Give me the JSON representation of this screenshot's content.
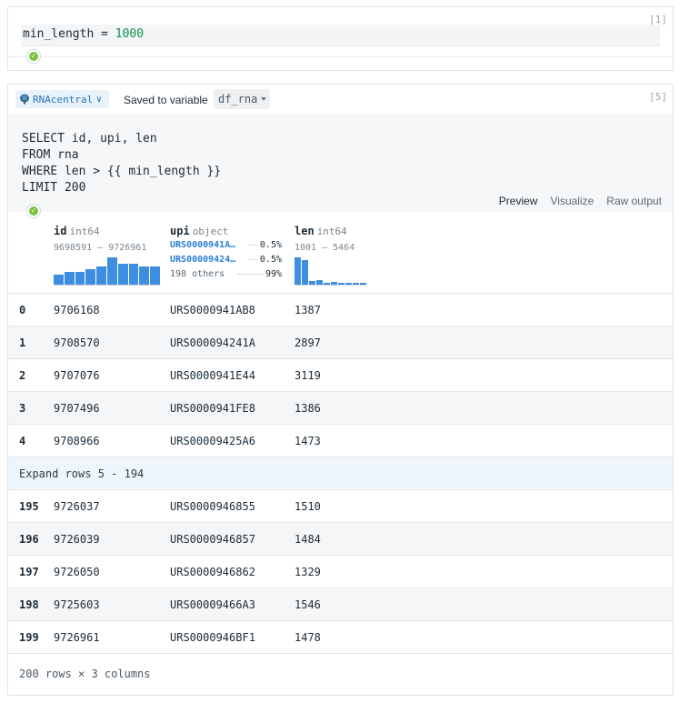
{
  "cell1": {
    "exec_count": "[1]",
    "code_var": "min_length = ",
    "code_num": "1000"
  },
  "cell2": {
    "exec_count": "[5]",
    "connection": "RNAcentral",
    "saved_label": "Saved to variable",
    "variable": "df_rna",
    "sql": [
      "SELECT id, upi, len",
      "FROM rna",
      "WHERE len > {{ min_length }}",
      "LIMIT 200"
    ],
    "tabs": [
      "Preview",
      "Visualize",
      "Raw output"
    ],
    "active_tab": "Preview"
  },
  "columns": [
    {
      "name": "id",
      "dtype": "int64",
      "range": "9698591 — 9726961",
      "hist": [
        0.38,
        0.48,
        0.48,
        0.58,
        0.68,
        1.0,
        0.78,
        0.78,
        0.68,
        0.68
      ]
    },
    {
      "name": "upi",
      "dtype": "object",
      "top": [
        {
          "value": "URS0000941A…",
          "pct": "0.5%"
        },
        {
          "value": "URS00009424…",
          "pct": "0.5%"
        },
        {
          "value": "198 others",
          "pct": "99%"
        }
      ]
    },
    {
      "name": "len",
      "dtype": "int64",
      "range": "1001 — 5464",
      "hist": [
        1.0,
        0.9,
        0.14,
        0.18,
        0.08,
        0.1,
        0.08,
        0.06,
        0.06,
        0.06
      ]
    }
  ],
  "rows_head": [
    {
      "idx": "0",
      "id": "9706168",
      "upi": "URS0000941AB8",
      "len": "1387"
    },
    {
      "idx": "1",
      "id": "9708570",
      "upi": "URS000094241A",
      "len": "2897"
    },
    {
      "idx": "2",
      "id": "9707076",
      "upi": "URS0000941E44",
      "len": "3119"
    },
    {
      "idx": "3",
      "id": "9707496",
      "upi": "URS0000941FE8",
      "len": "1386"
    },
    {
      "idx": "4",
      "id": "9708966",
      "upi": "URS00009425A6",
      "len": "1473"
    }
  ],
  "expand_label": "Expand rows 5 - 194",
  "rows_tail": [
    {
      "idx": "195",
      "id": "9726037",
      "upi": "URS0000946855",
      "len": "1510"
    },
    {
      "idx": "196",
      "id": "9726039",
      "upi": "URS0000946857",
      "len": "1484"
    },
    {
      "idx": "197",
      "id": "9726050",
      "upi": "URS0000946862",
      "len": "1329"
    },
    {
      "idx": "198",
      "id": "9725603",
      "upi": "URS00009466A3",
      "len": "1546"
    },
    {
      "idx": "199",
      "id": "9726961",
      "upi": "URS0000946BF1",
      "len": "1478"
    }
  ],
  "summary": "200 rows × 3 columns",
  "colors": {
    "accent": "#2b7fd4",
    "hist_bar": "#3d8ee0",
    "success": "#7cc13e"
  }
}
